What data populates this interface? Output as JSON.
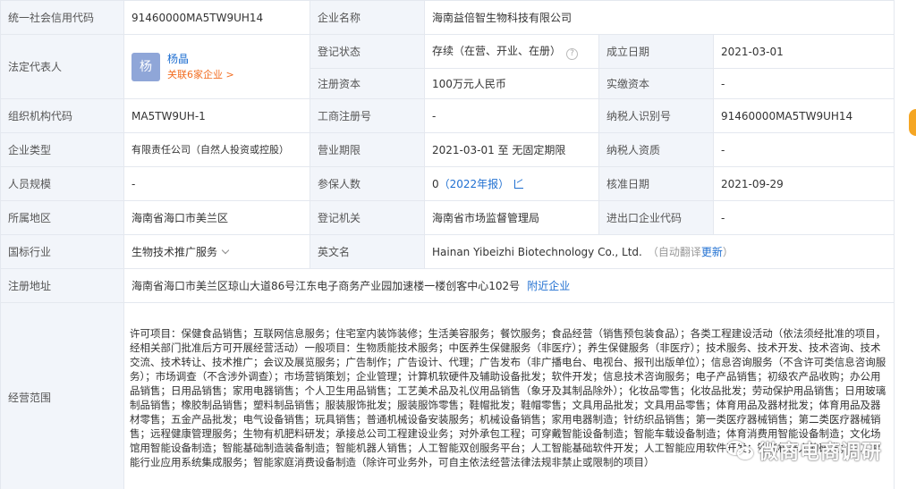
{
  "rows": {
    "credit_code": {
      "label": "统一社会信用代码",
      "value": "91460000MA5TW9UH14"
    },
    "company_name": {
      "label": "企业名称",
      "value": "海南益倍智生物科技有限公司"
    },
    "legal_rep": {
      "label": "法定代表人",
      "avatar": "杨",
      "name": "杨晶",
      "assoc": "关联6家企业 >"
    },
    "reg_status": {
      "label": "登记状态",
      "value": "存续（在营、开业、在册）"
    },
    "founded": {
      "label": "成立日期",
      "value": "2021-03-01"
    },
    "reg_capital": {
      "label": "注册资本",
      "value": "100万元人民币"
    },
    "paid_capital": {
      "label": "实缴资本",
      "value": "-"
    },
    "org_code": {
      "label": "组织机构代码",
      "value": "MA5TW9UH-1"
    },
    "biz_reg_no": {
      "label": "工商注册号",
      "value": "-"
    },
    "taxpayer_id": {
      "label": "纳税人识别号",
      "value": "91460000MA5TW9UH14"
    },
    "company_type": {
      "label": "企业类型",
      "value": "有限责任公司（自然人投资或控股）"
    },
    "term": {
      "label": "营业期限",
      "value": "2021-03-01 至 无固定期限"
    },
    "taxpayer_qual": {
      "label": "纳税人资质",
      "value": "-"
    },
    "staff_size": {
      "label": "人员规模",
      "value": "-"
    },
    "insured": {
      "label": "参保人数",
      "value": "0",
      "year": "（2022年报）"
    },
    "approved": {
      "label": "核准日期",
      "value": "2021-09-29"
    },
    "region": {
      "label": "所属地区",
      "value": "海南省海口市美兰区"
    },
    "reg_authority": {
      "label": "登记机关",
      "value": "海南省市场监督管理局"
    },
    "import_export": {
      "label": "进出口企业代码",
      "value": "-"
    },
    "industry": {
      "label": "国标行业",
      "value": "生物技术推广服务"
    },
    "english_name": {
      "label": "英文名",
      "value": "Hainan Yibeizhi Biotechnology Co., Ltd.",
      "note_prefix": "（自动翻译",
      "note_link": "更新",
      "note_suffix": "）"
    },
    "address": {
      "label": "注册地址",
      "value": "海南省海口市美兰区琼山大道86号江东电子商务产业园加速楼一楼创客中心102号",
      "link": "附近企业"
    },
    "scope": {
      "label": "经营范围",
      "value": "许可项目：保健食品销售；互联网信息服务；住宅室内装饰装修；生活美容服务；餐饮服务；食品经营（销售预包装食品）；各类工程建设活动（依法须经批准的项目，经相关部门批准后方可开展经营活动）一般项目：生物质能技术服务；中医养生保健服务（非医疗）；养生保健服务（非医疗）；技术服务、技术开发、技术咨询、技术交流、技术转让、技术推广；会议及展览服务；广告制作；广告设计、代理；广告发布（非广播电台、电视台、报刊出版单位）；信息咨询服务（不含许可类信息咨询服务）；市场调查（不含涉外调查）；市场营销策划；企业管理；计算机软硬件及辅助设备批发；软件开发；信息技术咨询服务；电子产品销售；初级农产品收购；办公用品销售；日用品销售；家用电器销售；个人卫生用品销售；工艺美术品及礼仪用品销售（象牙及其制品除外）；化妆品零售；化妆品批发；劳动保护用品销售；日用玻璃制品销售；橡胶制品销售；塑料制品销售；服装服饰批发；服装服饰零售；鞋帽批发；鞋帽零售；文具用品批发；文具用品零售；体育用品及器材批发；体育用品及器材零售；五金产品批发；电气设备销售；玩具销售；普通机械设备安装服务；机械设备销售；家用电器制造；针纺织品销售；第一类医疗器械销售；第二类医疗器械销售；远程健康管理服务；生物有机肥料研发；承接总公司工程建设业务；对外承包工程；可穿戴智能设备制造；智能车载设备制造；体育消费用智能设备制造；文化场馆用智能设备制造；智能基础制造装备制造；智能机器人销售；人工智能双创服务平台；人工智能基础软件开发；人工智能应用软件开发；智能机器人的研发；人工智能行业应用系统集成服务；智能家庭消费设备制造（除许可业务外，可自主依法经营法律法规非禁止或限制的项目）"
    }
  },
  "watermark": "微商电商调研",
  "colors": {
    "label_bg": "#f2f5fa",
    "border": "#e4e8ef",
    "link": "#1f6fd1",
    "accent_orange": "#f26d21",
    "side_tab": "#f5a623"
  }
}
